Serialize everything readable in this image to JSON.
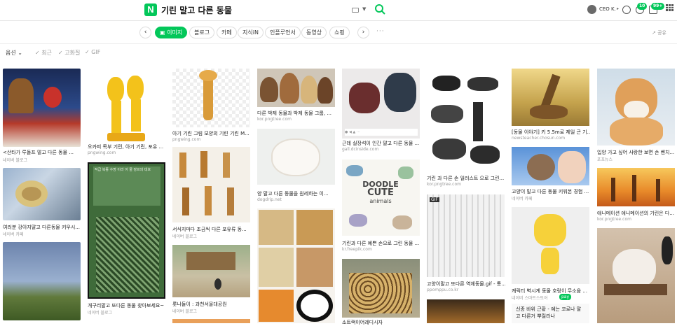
{
  "header": {
    "logo": "N",
    "query": "기린 말고 다른 동물",
    "user": "CEO K.",
    "badges": [
      "10",
      "99+"
    ]
  },
  "tabs": {
    "prev": "‹",
    "next": "›",
    "items": [
      "이미지",
      "블로그",
      "카페",
      "지식iN",
      "인플루언서",
      "동영상",
      "쇼핑"
    ],
    "more": "···",
    "share": "공유"
  },
  "filters": {
    "option": "옵션",
    "recent": "최근",
    "hd": "고화질",
    "gif": "GIF"
  },
  "results": [
    {
      "caption": "<산타가 루돌프 말고 다른 동물 ...",
      "source": "네이버 블로그"
    },
    {
      "caption": "여러분 강아지말고 다른동물 키우시...",
      "source": "네이버 카페"
    },
    {
      "caption": "오카피 목부 기린, 아기 기린, 포유 ...",
      "source": "pngwing.com"
    },
    {
      "caption": "개구리말고 또다른 동물 찾아보세요~",
      "source": "네이버 블로그"
    },
    {
      "caption": "아기 기린 그림 모양의 기린 기린 M...",
      "source": "pngwing.com"
    },
    {
      "caption": "서식지마다 조금씩 다른 포유류 동...",
      "source": "네이버 블로그"
    },
    {
      "caption": "롯나들이 : 과천서울대공원",
      "source": "네이버 블로그"
    },
    {
      "caption": "다른 박제 동물과 박제 동물 그룹, ...",
      "source": "kor.pngtree.com"
    },
    {
      "caption": "양 말고 다른 동물을 원레하는 이...",
      "source": "dogdrip.net"
    },
    {
      "caption": "근데 실장석이 인간 말고 다른 동물 ...",
      "source": "gall.dcinside.com"
    },
    {
      "caption": "기린과 다른 예쁜 손으로 그린 동물 ...",
      "source": "kr.freepik.com"
    },
    {
      "caption": "소트랙이어레디시자",
      "source": ""
    },
    {
      "caption": "기린 과 다른 손 일러스트 으로 그린...",
      "source": "kor.pngtree.com"
    },
    {
      "caption": "고양이말고 또다른 역체동물.gif - 통...",
      "source": "ppomppu.co.kr"
    },
    {
      "caption": "[동물 이야기] 키 5.5m로 제일 큰 기...",
      "source": "newsteacher.chosun.com"
    },
    {
      "caption": "고양이 말고 다른 동물 키워본 경험 ...",
      "source": "네이버 카페"
    },
    {
      "caption": "캐릭터 벽시계 동물 호랑이 무소음 ...",
      "source": "네이버 스마트스토어"
    },
    {
      "caption": "신종 바위 근황 - 예는 코로나 말고 다른거 뿌릴라나",
      "source": ""
    },
    {
      "caption": "입양 가고 싶어 사랑한 보면 손 벤치...",
      "source": "포포뉴스"
    },
    {
      "caption": "애니메이션 애니메이션의 기린은 다...",
      "source": "kor.pngtree.com"
    }
  ],
  "snippet": {
    "text": "작급 복종 수명 이라 어 물 장르의 대호",
    "doodle": [
      "DOODLE",
      "CUTE",
      "animals"
    ],
    "naverpay": "pay"
  }
}
